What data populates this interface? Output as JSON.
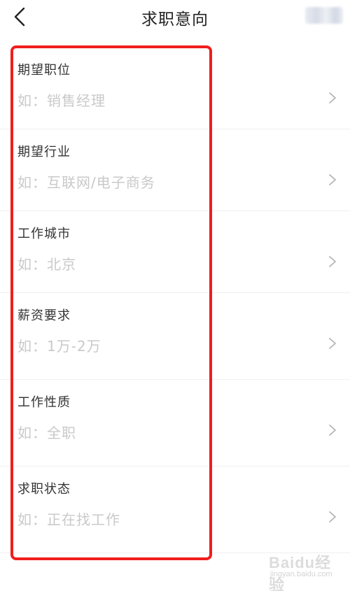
{
  "header": {
    "title": "求职意向"
  },
  "fields": [
    {
      "label": "期望职位",
      "placeholder": "如：销售经理"
    },
    {
      "label": "期望行业",
      "placeholder": "如：互联网/电子商务"
    },
    {
      "label": "工作城市",
      "placeholder": "如：北京"
    },
    {
      "label": "薪资要求",
      "placeholder": "如：1万-2万"
    },
    {
      "label": "工作性质",
      "placeholder": "如：全职"
    },
    {
      "label": "求职状态",
      "placeholder": "如：正在找工作"
    }
  ],
  "watermark": {
    "brand": "Baidu经验",
    "url": "jingyan.baidu.com"
  },
  "colors": {
    "highlight": "#f01e1e",
    "label": "#333333",
    "placeholder": "#c9c9c9",
    "chevron": "#b5b5b5"
  }
}
